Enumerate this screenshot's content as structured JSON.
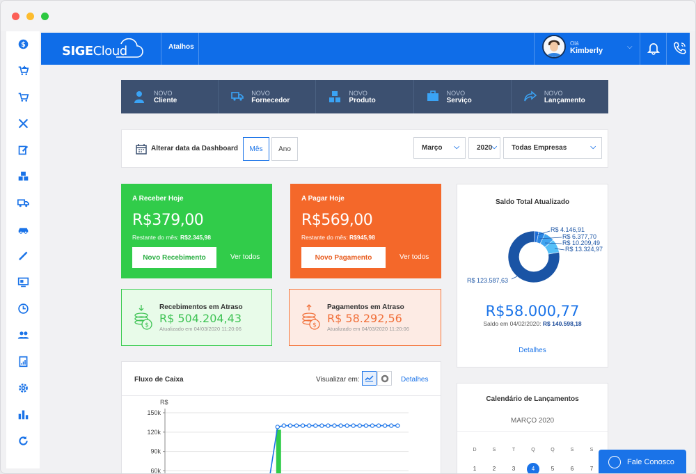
{
  "topbar": {
    "logo_text": "SIGE",
    "logo_cloud": "Cloud",
    "atalhos": "Atalhos",
    "greeting": "Olá",
    "user_name": "Kimberly"
  },
  "sidebar": {
    "icons": [
      "dollar-icon",
      "cart-add-icon",
      "cart-icon",
      "tools-icon",
      "edit-icon",
      "boxes-icon",
      "truck-icon",
      "car-icon",
      "pen-icon",
      "monitor-icon",
      "clock-icon",
      "users-icon",
      "report-icon",
      "gear-icon",
      "bar-chart-icon",
      "refresh-icon"
    ]
  },
  "shortcuts": [
    {
      "top": "NOVO",
      "label": "Cliente"
    },
    {
      "top": "NOVO",
      "label": "Fornecedor"
    },
    {
      "top": "NOVO",
      "label": "Produto"
    },
    {
      "top": "NOVO",
      "label": "Serviço"
    },
    {
      "top": "NOVO",
      "label": "Lançamento"
    }
  ],
  "datebar": {
    "label": "Alterar data da Dashboard",
    "mes": "Mês",
    "ano": "Ano",
    "month": "Março",
    "year": "2020",
    "company": "Todas Empresas"
  },
  "receber": {
    "title": "A Receber Hoje",
    "value": "R$379,00",
    "rest_label": "Restante do mês:",
    "rest_value": "R$2.345,98",
    "button": "Novo Recebimento",
    "link": "Ver todos"
  },
  "pagar": {
    "title": "A Pagar Hoje",
    "value": "R$569,00",
    "rest_label": "Restante do mês:",
    "rest_value": "R$945,98",
    "button": "Novo Pagamento",
    "link": "Ver todos"
  },
  "rec_atraso": {
    "title": "Recebimentos em Atraso",
    "value": "R$ 504.204,43",
    "updated": "Atualizado em 04/03/2020 11:20:06"
  },
  "pag_atraso": {
    "title": "Pagamentos em Atraso",
    "value": "R$ 58.292,56",
    "updated": "Atualizado em 04/03/2020 11:20:06"
  },
  "saldo": {
    "title": "Saldo Total Atualizado",
    "slices": [
      {
        "label": "R$ 4.146,91",
        "value": 4146.91,
        "color": "#1e6fd9"
      },
      {
        "label": "R$ 6.377,70",
        "value": 6377.7,
        "color": "#2a86e3"
      },
      {
        "label": "R$ 10.209,49",
        "value": 10209.49,
        "color": "#3fa4f0"
      },
      {
        "label": "R$ 13.324,97",
        "value": 13324.97,
        "color": "#55bff7"
      },
      {
        "label": "R$ 123.587,63",
        "value": 123587.63,
        "color": "#1a54a5"
      }
    ],
    "total": "R$58.000,77",
    "date_label": "Saldo em 04/02/2020:",
    "date_value": "R$ 140.598,18",
    "details": "Detalhes"
  },
  "fluxo": {
    "title": "Fluxo de Caixa",
    "view_label": "Visualizar em:",
    "details": "Detalhes",
    "chart_data": {
      "type": "line",
      "ylabel": "R$",
      "yticks": [
        "150k",
        "120k",
        "90k",
        "60k"
      ],
      "ylim": [
        40000,
        150000
      ],
      "series": [
        {
          "values": [
            0,
            0,
            128000,
            130000,
            130000,
            130000,
            130000,
            130000,
            130000,
            130000,
            130000,
            130000,
            130000,
            130000,
            130000,
            130000,
            130000,
            130000,
            130000,
            130000,
            130000,
            130000
          ]
        }
      ]
    }
  },
  "calendar": {
    "title": "Calendário de Lançamentos",
    "month": "MARÇO 2020",
    "weekdays": [
      "D",
      "S",
      "T",
      "Q",
      "Q",
      "S",
      "S"
    ],
    "first_row": [
      "1",
      "2",
      "3",
      "4",
      "5",
      "6",
      "7"
    ],
    "today": "4"
  },
  "chat": {
    "label": "Fale Conosco"
  },
  "colors": {
    "brand": "#0f6de8",
    "green": "#31cc4a",
    "orange": "#f4682a",
    "navy": "#3c5070"
  }
}
